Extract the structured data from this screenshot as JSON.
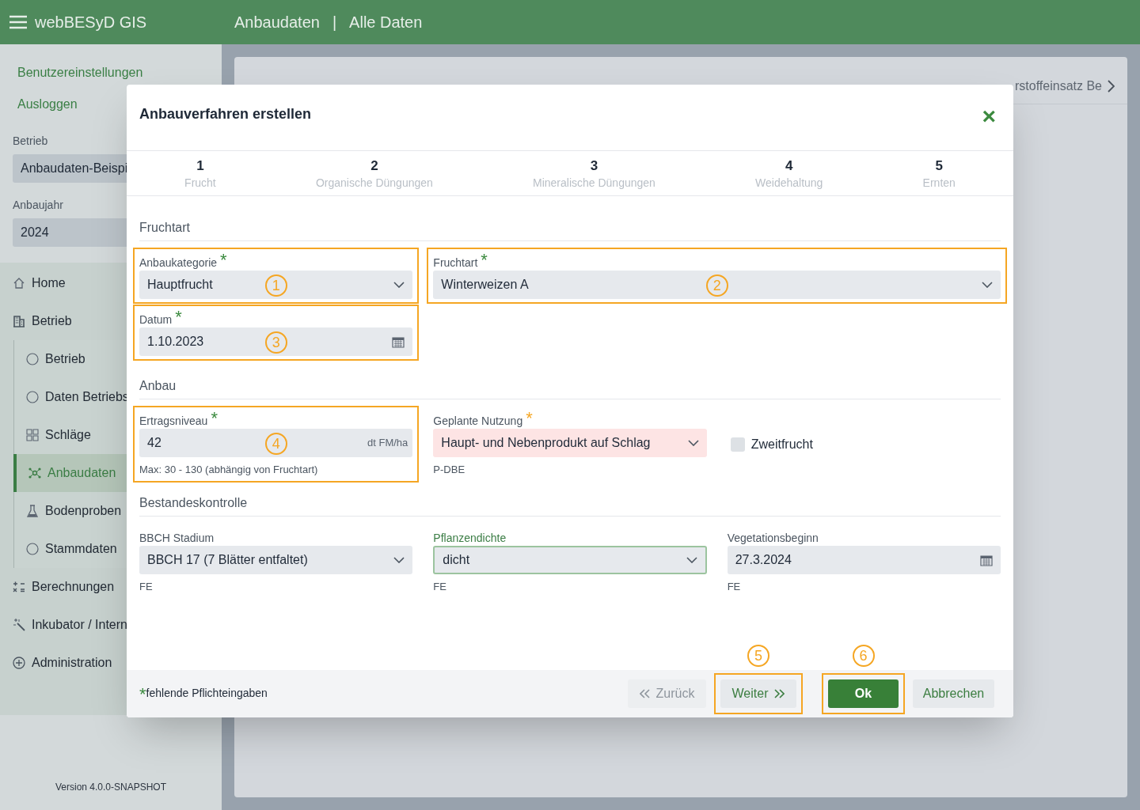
{
  "header": {
    "app_title": "webBESyD GIS",
    "breadcrumb": [
      "Anbaudaten",
      "Alle Daten"
    ],
    "separator": "|"
  },
  "sidebar": {
    "links": [
      "Benutzereinstellungen",
      "Ausloggen"
    ],
    "selects": [
      {
        "label": "Betrieb",
        "value": "Anbaudaten-Beispi"
      },
      {
        "label": "Anbaujahr",
        "value": "2024"
      }
    ],
    "nav": [
      {
        "kind": "home",
        "label": "Home",
        "selected": false
      },
      {
        "kind": "building",
        "label": "Betrieb",
        "selected": false,
        "children": [
          {
            "kind": "circle",
            "label": "Betrieb",
            "selected": false
          },
          {
            "kind": "circle",
            "label": "Daten Betriebs",
            "selected": false
          },
          {
            "kind": "grid",
            "label": "Schläge",
            "selected": false
          },
          {
            "kind": "network",
            "label": "Anbaudaten",
            "selected": true
          },
          {
            "kind": "flask",
            "label": "Bodenproben",
            "selected": false
          },
          {
            "kind": "circle",
            "label": "Stammdaten",
            "selected": false
          }
        ]
      },
      {
        "kind": "calc",
        "label": "Berechnungen",
        "selected": false
      },
      {
        "kind": "wand",
        "label": "Inkubator / Intern",
        "selected": false
      },
      {
        "kind": "plus",
        "label": "Administration",
        "selected": false
      }
    ],
    "version": "Version 4.0.0-SNAPSHOT"
  },
  "background_card": {
    "tabs": [
      {
        "label": "rstoffeinsatz Be",
        "selected": false
      }
    ]
  },
  "dialog": {
    "title": "Anbauverfahren erstellen",
    "close": "×",
    "steps": [
      {
        "number": "1",
        "label": "Frucht"
      },
      {
        "number": "2",
        "label": "Organische Düngungen"
      },
      {
        "number": "3",
        "label": "Mineralische Düngungen"
      },
      {
        "number": "4",
        "label": "Weidehaltung"
      },
      {
        "number": "5",
        "label": "Ernten"
      }
    ],
    "sections": [
      {
        "title": "Fruchtart",
        "rows": [
          [
            {
              "kind": "select",
              "label": "Anbaukategorie",
              "required": true,
              "invalid": false,
              "focused": false,
              "value": "Hauptfrucht",
              "annotation": "1",
              "wide": false
            },
            {
              "kind": "select",
              "label": "Fruchtart",
              "required": true,
              "invalid": false,
              "focused": false,
              "value": "Winterweizen A",
              "annotation": "2",
              "wide": true
            }
          ],
          [
            {
              "kind": "date",
              "label": "Datum",
              "required": true,
              "invalid": false,
              "focused": false,
              "value": "1.10.2023",
              "annotation": "3",
              "wide": false
            }
          ]
        ]
      },
      {
        "title": "Anbau",
        "rows": [
          [
            {
              "kind": "number",
              "label": "Ertragsniveau",
              "required": true,
              "invalid": false,
              "focused": false,
              "value": "42",
              "unit": "dt FM/ha",
              "hint": "Max: 30 - 130 (abhängig von Fruchtart)",
              "annotation": "4",
              "wide": false
            },
            {
              "kind": "select",
              "label": "Geplante Nutzung",
              "required": true,
              "invalid": true,
              "focused": false,
              "value": "Haupt- und Nebenprodukt auf Schlag",
              "hint": "P-DBE",
              "wide": false
            },
            {
              "kind": "checkbox",
              "label": "Zweitfrucht",
              "checked": false
            }
          ]
        ]
      },
      {
        "title": "Bestandeskontrolle",
        "rows": [
          [
            {
              "kind": "select",
              "label": "BBCH Stadium",
              "required": false,
              "invalid": false,
              "focused": false,
              "value": "BBCH 17 (7 Blätter entfaltet)",
              "hint": "FE",
              "wide": false
            },
            {
              "kind": "select",
              "label": "Pflanzendichte",
              "required": false,
              "invalid": false,
              "focused": true,
              "value": "dicht",
              "hint": "FE",
              "wide": false
            },
            {
              "kind": "date",
              "label": "Vegetationsbeginn",
              "required": false,
              "invalid": false,
              "focused": false,
              "value": "27.3.2024",
              "hint": "FE",
              "wide": false
            }
          ]
        ]
      }
    ],
    "footer": {
      "asterisk": "*",
      "legend": "fehlende Pflichteingaben",
      "buttons": [
        {
          "kind": "back",
          "label": "Zurück",
          "disabled": true
        },
        {
          "kind": "next",
          "label": "Weiter",
          "disabled": false,
          "annotation": "5"
        },
        {
          "kind": "primary",
          "label": "Ok",
          "disabled": false,
          "annotation": "6"
        },
        {
          "kind": "plain",
          "label": "Abbrechen",
          "disabled": false
        }
      ]
    }
  }
}
